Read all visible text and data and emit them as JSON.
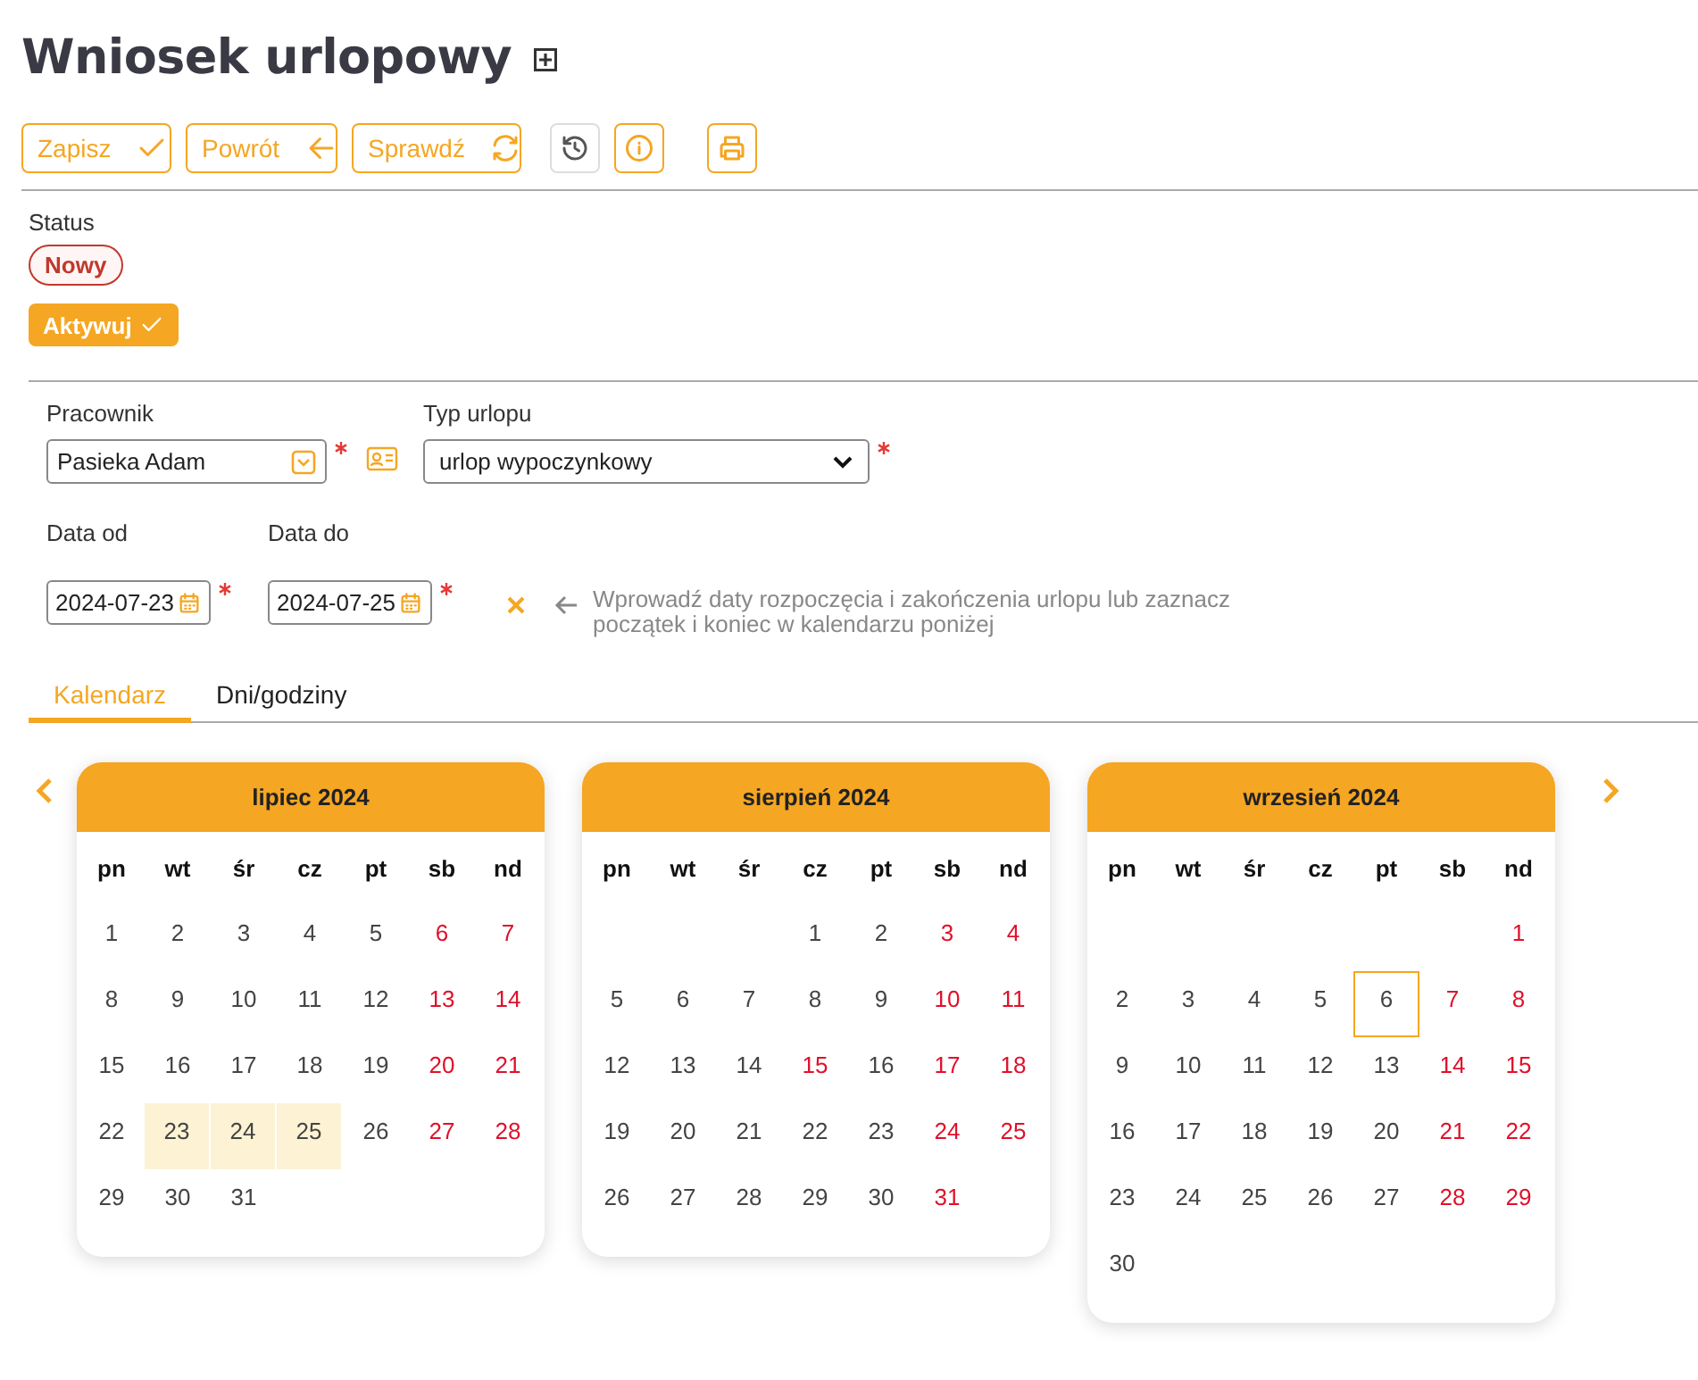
{
  "title": "Wniosek urlopowy",
  "toolbar": {
    "buttons": [
      {
        "label": "Zapisz"
      },
      {
        "label": "Powrót"
      },
      {
        "label": "Sprawdź"
      }
    ],
    "icon_buttons": [
      {
        "disabled": true
      },
      {
        "disabled": false
      },
      {
        "disabled": false
      }
    ]
  },
  "status": {
    "label": "Status",
    "badge": "Nowy",
    "action": "Aktywuj"
  },
  "form": {
    "employee": {
      "label": "Pracownik",
      "value": "Pasieka Adam",
      "required": true
    },
    "leave_type": {
      "label": "Typ urlopu",
      "value": "urlop wypoczynkowy",
      "required": true
    },
    "date_from": {
      "label": "Data od",
      "value": "2024-07-23",
      "required": true
    },
    "date_to": {
      "label": "Data do",
      "value": "2024-07-25",
      "required": true
    },
    "hint": "Wprowadź daty rozpoczęcia i zakończenia urlopu lub zaznacz początek i koniec w kalendarzu poniżej"
  },
  "tabs": [
    {
      "label": "Kalendarz",
      "selected": true
    },
    {
      "label": "Dni/godziny",
      "selected": false
    }
  ],
  "calendar": {
    "months": [
      {
        "title": "lipiec 2024",
        "weekdays": [
          "pn",
          "wt",
          "śr",
          "cz",
          "pt",
          "sb",
          "nd"
        ],
        "weeks": [
          [
            {
              "kind": "day",
              "text": "1",
              "free": false,
              "selected": false,
              "today": false
            },
            {
              "kind": "day",
              "text": "2",
              "free": false,
              "selected": false,
              "today": false
            },
            {
              "kind": "day",
              "text": "3",
              "free": false,
              "selected": false,
              "today": false
            },
            {
              "kind": "day",
              "text": "4",
              "free": false,
              "selected": false,
              "today": false
            },
            {
              "kind": "day",
              "text": "5",
              "free": false,
              "selected": false,
              "today": false
            },
            {
              "kind": "day",
              "text": "6",
              "free": true,
              "selected": false,
              "today": false
            },
            {
              "kind": "day",
              "text": "7",
              "free": true,
              "selected": false,
              "today": false
            }
          ],
          [
            {
              "kind": "day",
              "text": "8",
              "free": false,
              "selected": false,
              "today": false
            },
            {
              "kind": "day",
              "text": "9",
              "free": false,
              "selected": false,
              "today": false
            },
            {
              "kind": "day",
              "text": "10",
              "free": false,
              "selected": false,
              "today": false
            },
            {
              "kind": "day",
              "text": "11",
              "free": false,
              "selected": false,
              "today": false
            },
            {
              "kind": "day",
              "text": "12",
              "free": false,
              "selected": false,
              "today": false
            },
            {
              "kind": "day",
              "text": "13",
              "free": true,
              "selected": false,
              "today": false
            },
            {
              "kind": "day",
              "text": "14",
              "free": true,
              "selected": false,
              "today": false
            }
          ],
          [
            {
              "kind": "day",
              "text": "15",
              "free": false,
              "selected": false,
              "today": false
            },
            {
              "kind": "day",
              "text": "16",
              "free": false,
              "selected": false,
              "today": false
            },
            {
              "kind": "day",
              "text": "17",
              "free": false,
              "selected": false,
              "today": false
            },
            {
              "kind": "day",
              "text": "18",
              "free": false,
              "selected": false,
              "today": false
            },
            {
              "kind": "day",
              "text": "19",
              "free": false,
              "selected": false,
              "today": false
            },
            {
              "kind": "day",
              "text": "20",
              "free": true,
              "selected": false,
              "today": false
            },
            {
              "kind": "day",
              "text": "21",
              "free": true,
              "selected": false,
              "today": false
            }
          ],
          [
            {
              "kind": "day",
              "text": "22",
              "free": false,
              "selected": false,
              "today": false
            },
            {
              "kind": "day",
              "text": "23",
              "free": false,
              "selected": true,
              "today": false
            },
            {
              "kind": "day",
              "text": "24",
              "free": false,
              "selected": true,
              "today": false
            },
            {
              "kind": "day",
              "text": "25",
              "free": false,
              "selected": true,
              "today": false
            },
            {
              "kind": "day",
              "text": "26",
              "free": false,
              "selected": false,
              "today": false
            },
            {
              "kind": "day",
              "text": "27",
              "free": true,
              "selected": false,
              "today": false
            },
            {
              "kind": "day",
              "text": "28",
              "free": true,
              "selected": false,
              "today": false
            }
          ],
          [
            {
              "kind": "day",
              "text": "29",
              "free": false,
              "selected": false,
              "today": false
            },
            {
              "kind": "day",
              "text": "30",
              "free": false,
              "selected": false,
              "today": false
            },
            {
              "kind": "day",
              "text": "31",
              "free": false,
              "selected": false,
              "today": false
            }
          ]
        ]
      },
      {
        "title": "sierpień 2024",
        "weekdays": [
          "pn",
          "wt",
          "śr",
          "cz",
          "pt",
          "sb",
          "nd"
        ],
        "weeks": [
          [
            {
              "kind": "blank"
            },
            {
              "kind": "blank"
            },
            {
              "kind": "blank"
            },
            {
              "kind": "day",
              "text": "1",
              "free": false,
              "selected": false,
              "today": false
            },
            {
              "kind": "day",
              "text": "2",
              "free": false,
              "selected": false,
              "today": false
            },
            {
              "kind": "day",
              "text": "3",
              "free": true,
              "selected": false,
              "today": false
            },
            {
              "kind": "day",
              "text": "4",
              "free": true,
              "selected": false,
              "today": false
            }
          ],
          [
            {
              "kind": "day",
              "text": "5",
              "free": false,
              "selected": false,
              "today": false
            },
            {
              "kind": "day",
              "text": "6",
              "free": false,
              "selected": false,
              "today": false
            },
            {
              "kind": "day",
              "text": "7",
              "free": false,
              "selected": false,
              "today": false
            },
            {
              "kind": "day",
              "text": "8",
              "free": false,
              "selected": false,
              "today": false
            },
            {
              "kind": "day",
              "text": "9",
              "free": false,
              "selected": false,
              "today": false
            },
            {
              "kind": "day",
              "text": "10",
              "free": true,
              "selected": false,
              "today": false
            },
            {
              "kind": "day",
              "text": "11",
              "free": true,
              "selected": false,
              "today": false
            }
          ],
          [
            {
              "kind": "day",
              "text": "12",
              "free": false,
              "selected": false,
              "today": false
            },
            {
              "kind": "day",
              "text": "13",
              "free": false,
              "selected": false,
              "today": false
            },
            {
              "kind": "day",
              "text": "14",
              "free": false,
              "selected": false,
              "today": false
            },
            {
              "kind": "day",
              "text": "15",
              "free": true,
              "selected": false,
              "today": false
            },
            {
              "kind": "day",
              "text": "16",
              "free": false,
              "selected": false,
              "today": false
            },
            {
              "kind": "day",
              "text": "17",
              "free": true,
              "selected": false,
              "today": false
            },
            {
              "kind": "day",
              "text": "18",
              "free": true,
              "selected": false,
              "today": false
            }
          ],
          [
            {
              "kind": "day",
              "text": "19",
              "free": false,
              "selected": false,
              "today": false
            },
            {
              "kind": "day",
              "text": "20",
              "free": false,
              "selected": false,
              "today": false
            },
            {
              "kind": "day",
              "text": "21",
              "free": false,
              "selected": false,
              "today": false
            },
            {
              "kind": "day",
              "text": "22",
              "free": false,
              "selected": false,
              "today": false
            },
            {
              "kind": "day",
              "text": "23",
              "free": false,
              "selected": false,
              "today": false
            },
            {
              "kind": "day",
              "text": "24",
              "free": true,
              "selected": false,
              "today": false
            },
            {
              "kind": "day",
              "text": "25",
              "free": true,
              "selected": false,
              "today": false
            }
          ],
          [
            {
              "kind": "day",
              "text": "26",
              "free": false,
              "selected": false,
              "today": false
            },
            {
              "kind": "day",
              "text": "27",
              "free": false,
              "selected": false,
              "today": false
            },
            {
              "kind": "day",
              "text": "28",
              "free": false,
              "selected": false,
              "today": false
            },
            {
              "kind": "day",
              "text": "29",
              "free": false,
              "selected": false,
              "today": false
            },
            {
              "kind": "day",
              "text": "30",
              "free": false,
              "selected": false,
              "today": false
            },
            {
              "kind": "day",
              "text": "31",
              "free": true,
              "selected": false,
              "today": false
            }
          ]
        ]
      },
      {
        "title": "wrzesień 2024",
        "weekdays": [
          "pn",
          "wt",
          "śr",
          "cz",
          "pt",
          "sb",
          "nd"
        ],
        "weeks": [
          [
            {
              "kind": "blank"
            },
            {
              "kind": "blank"
            },
            {
              "kind": "blank"
            },
            {
              "kind": "blank"
            },
            {
              "kind": "blank"
            },
            {
              "kind": "blank"
            },
            {
              "kind": "day",
              "text": "1",
              "free": true,
              "selected": false,
              "today": false
            }
          ],
          [
            {
              "kind": "day",
              "text": "2",
              "free": false,
              "selected": false,
              "today": false
            },
            {
              "kind": "day",
              "text": "3",
              "free": false,
              "selected": false,
              "today": false
            },
            {
              "kind": "day",
              "text": "4",
              "free": false,
              "selected": false,
              "today": false
            },
            {
              "kind": "day",
              "text": "5",
              "free": false,
              "selected": false,
              "today": false
            },
            {
              "kind": "day",
              "text": "6",
              "free": false,
              "selected": false,
              "today": true
            },
            {
              "kind": "day",
              "text": "7",
              "free": true,
              "selected": false,
              "today": false
            },
            {
              "kind": "day",
              "text": "8",
              "free": true,
              "selected": false,
              "today": false
            }
          ],
          [
            {
              "kind": "day",
              "text": "9",
              "free": false,
              "selected": false,
              "today": false
            },
            {
              "kind": "day",
              "text": "10",
              "free": false,
              "selected": false,
              "today": false
            },
            {
              "kind": "day",
              "text": "11",
              "free": false,
              "selected": false,
              "today": false
            },
            {
              "kind": "day",
              "text": "12",
              "free": false,
              "selected": false,
              "today": false
            },
            {
              "kind": "day",
              "text": "13",
              "free": false,
              "selected": false,
              "today": false
            },
            {
              "kind": "day",
              "text": "14",
              "free": true,
              "selected": false,
              "today": false
            },
            {
              "kind": "day",
              "text": "15",
              "free": true,
              "selected": false,
              "today": false
            }
          ],
          [
            {
              "kind": "day",
              "text": "16",
              "free": false,
              "selected": false,
              "today": false
            },
            {
              "kind": "day",
              "text": "17",
              "free": false,
              "selected": false,
              "today": false
            },
            {
              "kind": "day",
              "text": "18",
              "free": false,
              "selected": false,
              "today": false
            },
            {
              "kind": "day",
              "text": "19",
              "free": false,
              "selected": false,
              "today": false
            },
            {
              "kind": "day",
              "text": "20",
              "free": false,
              "selected": false,
              "today": false
            },
            {
              "kind": "day",
              "text": "21",
              "free": true,
              "selected": false,
              "today": false
            },
            {
              "kind": "day",
              "text": "22",
              "free": true,
              "selected": false,
              "today": false
            }
          ],
          [
            {
              "kind": "day",
              "text": "23",
              "free": false,
              "selected": false,
              "today": false
            },
            {
              "kind": "day",
              "text": "24",
              "free": false,
              "selected": false,
              "today": false
            },
            {
              "kind": "day",
              "text": "25",
              "free": false,
              "selected": false,
              "today": false
            },
            {
              "kind": "day",
              "text": "26",
              "free": false,
              "selected": false,
              "today": false
            },
            {
              "kind": "day",
              "text": "27",
              "free": false,
              "selected": false,
              "today": false
            },
            {
              "kind": "day",
              "text": "28",
              "free": true,
              "selected": false,
              "today": false
            },
            {
              "kind": "day",
              "text": "29",
              "free": true,
              "selected": false,
              "today": false
            }
          ],
          [
            {
              "kind": "day",
              "text": "30",
              "free": false,
              "selected": false,
              "today": false
            }
          ]
        ]
      }
    ]
  }
}
